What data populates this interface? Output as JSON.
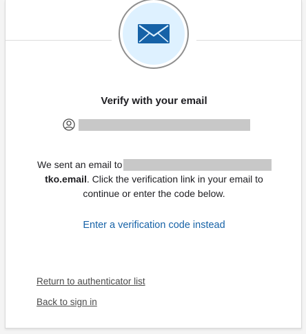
{
  "header": {
    "icon": "email-envelope-icon",
    "accent_color": "#1662a7",
    "icon_bg_color": "#def1ff"
  },
  "title": "Verify with your email",
  "identifier": {
    "icon": "user-icon",
    "value_redacted": true
  },
  "message": {
    "prefix": "We sent an email to",
    "email_suffix": "tko.email",
    "rest_line2": ". Click the verification link in your email to",
    "line3": "continue or enter the code below."
  },
  "actions": {
    "enter_code_label": "Enter a verification code instead"
  },
  "footer": {
    "return_label": "Return to authenticator list",
    "back_label": "Back to sign in"
  }
}
